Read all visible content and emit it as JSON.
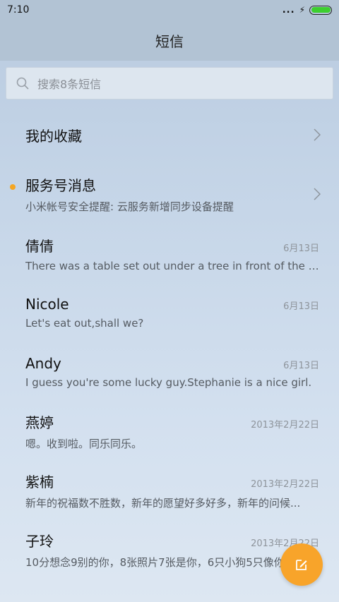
{
  "status_bar": {
    "time": "7:10",
    "dots": "...",
    "bolt": "⚡"
  },
  "header": {
    "title": "短信"
  },
  "search": {
    "placeholder": "搜索8条短信"
  },
  "favorites": {
    "label": "我的收藏"
  },
  "service": {
    "label": "服务号消息",
    "preview": "小米帐号安全提醒: 云服务新增同步设备提醒",
    "unread_color": "#f5a623"
  },
  "conversations": [
    {
      "name": "倩倩",
      "date": "6月13日",
      "preview": "There was a table set out under a tree in front of the ho..."
    },
    {
      "name": "Nicole",
      "date": "6月13日",
      "preview": "Let's eat out,shall we?"
    },
    {
      "name": "Andy",
      "date": "6月13日",
      "preview": "I guess you're some lucky guy.Stephanie is a nice girl."
    },
    {
      "name": "燕婷",
      "date": "2013年2月22日",
      "preview": "嗯。收到啦。同乐同乐。"
    },
    {
      "name": "紫楠",
      "date": "2013年2月22日",
      "preview": "新年的祝福数不胜数，新年的愿望好多好多，新年的问候..."
    },
    {
      "name": "子玲",
      "date": "2013年2月22日",
      "preview": "10分想念9别的你，8张照片7张是你，6只小狗5只像你..."
    }
  ],
  "fab": {
    "icon": "compose-icon",
    "color": "#f8a42a"
  }
}
